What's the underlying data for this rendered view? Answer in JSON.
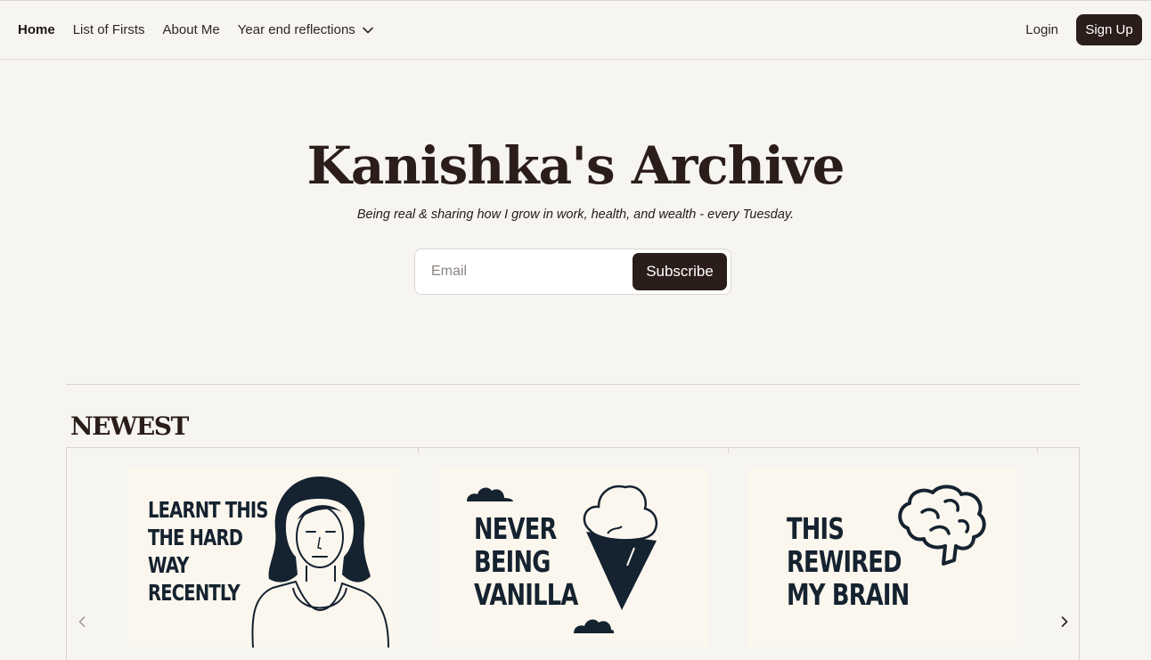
{
  "nav": {
    "links": [
      "Home",
      "List of Firsts",
      "About Me"
    ],
    "dropdown_label": "Year end reflections",
    "login": "Login",
    "signup": "Sign Up"
  },
  "hero": {
    "title": "Kanishka's Archive",
    "tagline": "Being real & sharing how I grow in work, health, and wealth - every Tuesday.",
    "email_placeholder": "Email",
    "subscribe_label": "Subscribe"
  },
  "newest": {
    "title": "NEWEST",
    "cards": [
      {
        "lines": [
          "LEARNT THIS",
          "THE HARD",
          "WAY",
          "RECENTLY"
        ],
        "icon": "woman-portrait-icon"
      },
      {
        "lines": [
          "NEVER",
          "BEING",
          "VANILLA"
        ],
        "icon": "ice-cream-cone-icon"
      },
      {
        "lines": [
          "THIS",
          "REWIRED",
          "MY BRAIN"
        ],
        "icon": "brain-icon"
      }
    ]
  },
  "colors": {
    "background": "#f7f5f1",
    "accent": "#2b1d1a",
    "card_text": "#15222f",
    "card_bg": "#fbf7ef"
  }
}
